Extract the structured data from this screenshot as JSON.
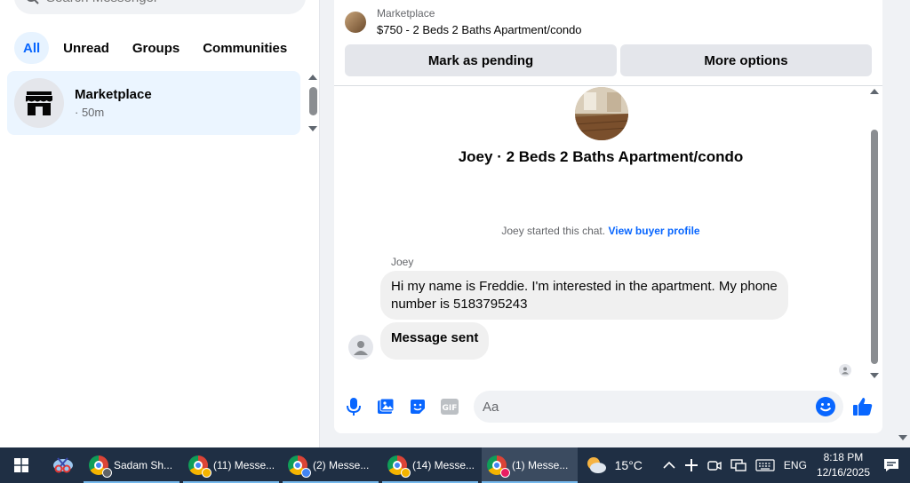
{
  "sidebar": {
    "search_placeholder": "Search Messenger",
    "tabs": [
      {
        "label": "All",
        "active": true
      },
      {
        "label": "Unread",
        "active": false
      },
      {
        "label": "Groups",
        "active": false
      },
      {
        "label": "Communities",
        "active": false
      }
    ],
    "chats": [
      {
        "name": "Marketplace",
        "time": "· 50m",
        "icon": "storefront-icon"
      }
    ]
  },
  "listing": {
    "label": "Marketplace",
    "title": "$750 - 2 Beds 2 Baths Apartment/condo",
    "mark_pending_label": "Mark as pending",
    "more_options_label": "More options"
  },
  "conversation": {
    "title": "Joey · 2 Beds 2 Baths Apartment/condo",
    "system_text": "Joey started this chat.",
    "system_link": "View buyer profile",
    "sender": "Joey",
    "messages": [
      {
        "text": "Hi my name is Freddie. I'm interested in the apartment. My phone number is 5183795243"
      },
      {
        "text": "Message sent"
      }
    ]
  },
  "composer": {
    "placeholder": "Aa"
  },
  "taskbar": {
    "apps": [
      {
        "label": "Sadam Sh...",
        "badge_color": "#5f6368",
        "active": false
      },
      {
        "label": "(11) Messe...",
        "badge_color": "#f4b400",
        "active": false
      },
      {
        "label": "(2) Messe...",
        "badge_color": "#4285f4",
        "active": false
      },
      {
        "label": "(14) Messe...",
        "badge_color": "#f4b400",
        "active": false
      },
      {
        "label": "(1) Messe...",
        "badge_color": "#e91e63",
        "active": true
      }
    ],
    "temperature": "15°C",
    "language": "ENG",
    "time": "8:18 PM",
    "date": "12/16/2025"
  },
  "colors": {
    "accent": "#0866ff",
    "active_chat_bg": "#ebf5ff",
    "taskbar_bg": "#1f2f44"
  }
}
